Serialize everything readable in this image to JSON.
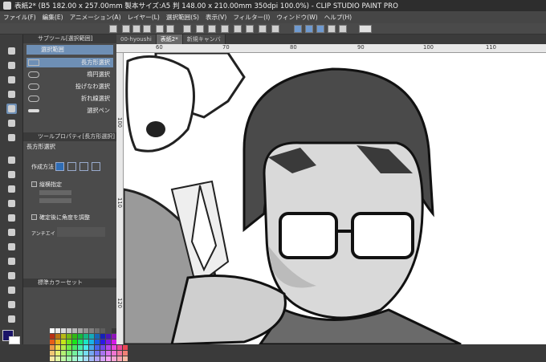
{
  "window": {
    "title": "表紙2* (B5 182.00 x 257.00mm 製本サイズ:A5 判 148.00 x 210.00mm 350dpi 100.0%) - CLIP STUDIO PAINT PRO"
  },
  "menu": [
    "ファイル(F)",
    "編集(E)",
    "アニメーション(A)",
    "レイヤー(L)",
    "選択範囲(S)",
    "表示(V)",
    "フィルター(I)",
    "ウィンドウ(W)",
    "ヘルプ(H)"
  ],
  "subtool": {
    "header": "サブツール[選択範囲]",
    "group": "選択範囲",
    "items": [
      "長方形選択",
      "楕円選択",
      "投げなわ選択",
      "折れ線選択",
      "選択ペン"
    ]
  },
  "toolprop": {
    "header": "ツールプロパティ[長方形選択]",
    "name": "長方形選択",
    "mode_label": "作成方法",
    "aspect_label": "縦横指定",
    "adjust_label": "確定後に角度を調整",
    "aa_label": "アンチエイ"
  },
  "colorset": {
    "header": "標準カラーセット"
  },
  "tabs": [
    "00-hyoushi",
    "表紙2*",
    "新規キャンバ"
  ],
  "ruler": {
    "top": [
      "60",
      "70",
      "80",
      "90",
      "100",
      "110"
    ],
    "left": [
      "100",
      "110",
      "120"
    ]
  },
  "colors": {
    "accent": "#2f6db5",
    "selection_row": "#6e8fb5",
    "main_color": "#1a1468"
  }
}
